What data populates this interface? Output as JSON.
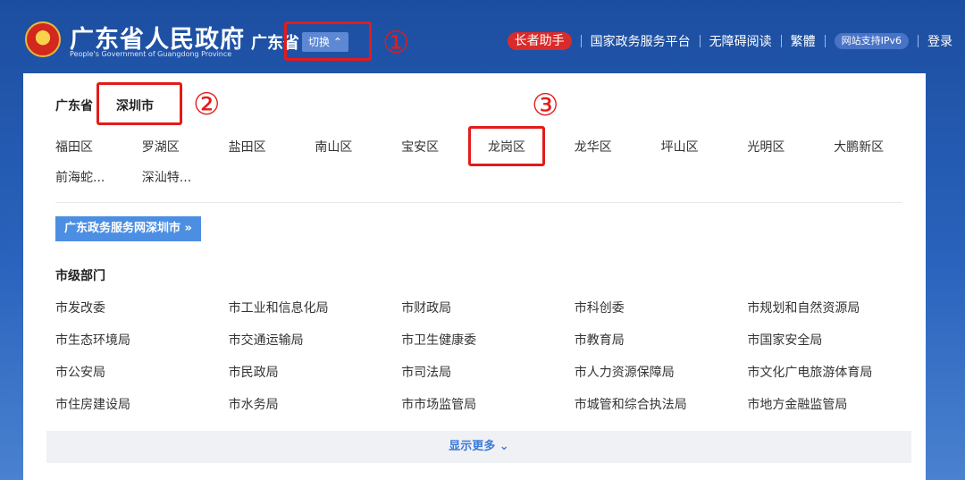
{
  "header": {
    "gov_title": "广东省人民政府",
    "gov_subtitle": "People's Government of Guangdong Province",
    "region_current": "广东省",
    "switch_label": "切换",
    "elder_helper": "长者助手",
    "nav_links": [
      "国家政务服务平台",
      "无障碍阅读",
      "繁體"
    ],
    "ipv6_badge": "网站支持IPv6",
    "login": "登录"
  },
  "annotations": {
    "one": "①",
    "two": "②",
    "three": "③",
    "color": "#e31b1b"
  },
  "panel": {
    "crumb_province": "广东省",
    "crumb_city": "深圳市",
    "districts": [
      "福田区",
      "罗湖区",
      "盐田区",
      "南山区",
      "宝安区",
      "龙岗区",
      "龙华区",
      "坪山区",
      "光明区",
      "大鹏新区",
      "前海蛇...",
      "深汕特..."
    ],
    "portal_button": "广东政务服务网深圳市 »",
    "section_title": "市级部门",
    "departments": [
      "市发改委",
      "市工业和信息化局",
      "市财政局",
      "市科创委",
      "市规划和自然资源局",
      "市生态环境局",
      "市交通运输局",
      "市卫生健康委",
      "市教育局",
      "市国家安全局",
      "市公安局",
      "市民政局",
      "市司法局",
      "市人力资源保障局",
      "市文化广电旅游体育局",
      "市住房建设局",
      "市水务局",
      "市市场监管局",
      "市城管和综合执法局",
      "市地方金融监管局"
    ],
    "show_more": "显示更多 ⌄"
  },
  "colors": {
    "header_bg": "#1c4ea0",
    "elder_red": "#d92b2b",
    "accent_blue": "#4c8fe2",
    "link_blue": "#3a7ad9"
  }
}
